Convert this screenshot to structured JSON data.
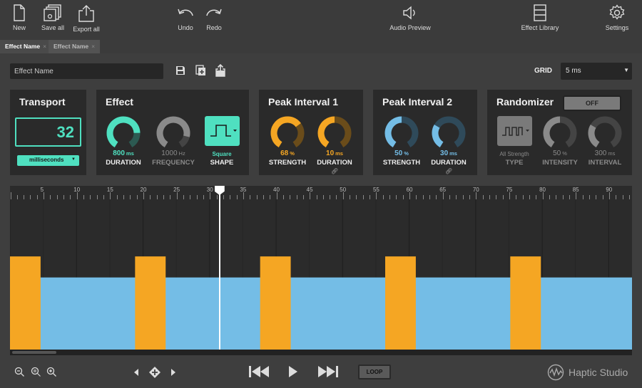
{
  "toolbar": {
    "new": "New",
    "save_all": "Save all",
    "export_all": "Export all",
    "undo": "Undo",
    "redo": "Redo",
    "audio_preview": "Audio Preview",
    "effect_library": "Effect Library",
    "settings": "Settings"
  },
  "tabs": [
    {
      "label": "Effect Name",
      "close": "×",
      "active": true
    },
    {
      "label": "Effect Name",
      "close": "×",
      "active": false
    }
  ],
  "effect_name_input": {
    "value": "Effect Name"
  },
  "grid": {
    "label": "GRID",
    "value": "5 ms"
  },
  "transport": {
    "title": "Transport",
    "value": "32",
    "unit": "milliseconds"
  },
  "effect": {
    "title": "Effect",
    "duration": {
      "value": "800",
      "unit": "ms",
      "label": "DURATION",
      "level": 0.8
    },
    "frequency": {
      "value": "1000",
      "unit": "Hz",
      "label": "FREQUENCY",
      "level": 0.85
    },
    "shape": {
      "value": "Square",
      "label": "SHAPE"
    }
  },
  "peak1": {
    "title": "Peak Interval 1",
    "strength": {
      "value": "68",
      "unit": "%",
      "label": "STRENGTH",
      "level": 0.68
    },
    "duration": {
      "value": "10",
      "unit": "ms",
      "label": "DURATION",
      "level": 0.5
    }
  },
  "peak2": {
    "title": "Peak Interval 2",
    "strength": {
      "value": "50",
      "unit": "%",
      "label": "STRENGTH",
      "level": 0.5
    },
    "duration": {
      "value": "30",
      "unit": "ms",
      "label": "DURATION",
      "level": 0.3
    }
  },
  "randomizer": {
    "title": "Randomizer",
    "toggle": "OFF",
    "type": {
      "value": "All Strength",
      "label": "TYPE"
    },
    "intensity": {
      "value": "50",
      "unit": "%",
      "label": "INTENSITY",
      "level": 0.5
    },
    "interval": {
      "value": "300",
      "unit": "ms",
      "label": "INTERVAL",
      "level": 0.3
    }
  },
  "ruler_labels": [
    "5",
    "10",
    "15",
    "20",
    "25",
    "30",
    "35",
    "40",
    "45",
    "50",
    "55",
    "60",
    "65",
    "70",
    "75",
    "80",
    "85",
    "90"
  ],
  "playhead_ms": 31.5,
  "waveform": {
    "peak_level": 0.62,
    "base_level": 0.48,
    "peaks": [
      [
        0,
        4.6
      ],
      [
        18.8,
        23.4
      ],
      [
        37.6,
        42.2
      ],
      [
        56.4,
        61.0
      ],
      [
        75.2,
        79.8
      ]
    ]
  },
  "loop_label": "LOOP",
  "brand": "Haptic Studio",
  "colors": {
    "teal": "#4fe0c0",
    "orange": "#f5a623",
    "blue": "#74bde6",
    "panel": "#2a2a2a"
  }
}
